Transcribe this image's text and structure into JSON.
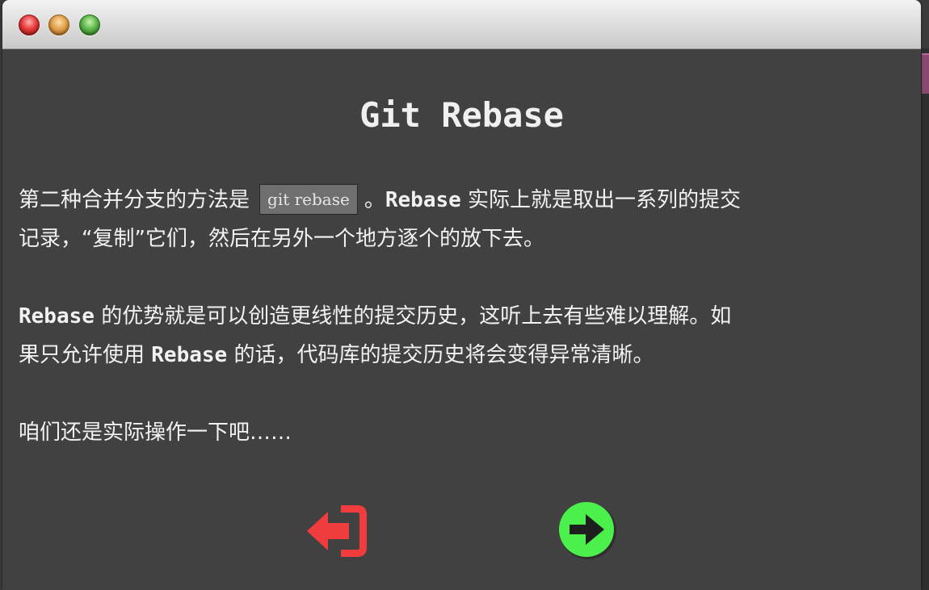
{
  "window": {
    "controls": [
      "close-button",
      "minimize-button",
      "zoom-button"
    ]
  },
  "dialog": {
    "title": "Git Rebase",
    "paragraph1": {
      "before": "第二种合并分支的方法是",
      "code": "git rebase",
      "after_punct": "。",
      "term": "Rebase",
      "rest_line1": "实际上就是取出一系列的提交",
      "rest_line2": "记录，“复制”它们，然后在另外一个地方逐个的放下去。"
    },
    "paragraph2": {
      "term1": "Rebase",
      "text1": "的优势就是可以创造更线性的提交历史，这听上去有些难以理解。如",
      "text2": "果只允许使用",
      "term2": "Rebase",
      "text3": "的话，代码库的提交历史将会变得异常清晰。"
    },
    "paragraph3": "咱们还是实际操作一下吧……"
  },
  "buttons": {
    "back": {
      "icon": "exit-icon",
      "color": "#f03c3c"
    },
    "next": {
      "icon": "arrow-right-icon",
      "color": "#4cf04c"
    }
  },
  "colors": {
    "background": "#414141",
    "text": "#f2f2f2",
    "code_bg": "#6f6f6f"
  }
}
